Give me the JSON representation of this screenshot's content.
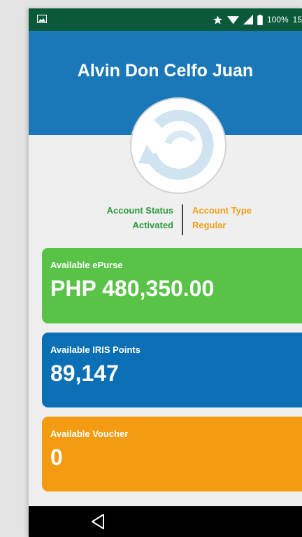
{
  "status_bar": {
    "battery_percent": "100%",
    "clock_partial": "15"
  },
  "profile": {
    "name": "Alvin Don Celfo Juan"
  },
  "account": {
    "status_label": "Account Status",
    "status_value": "Activated",
    "type_label": "Account Type",
    "type_value": "Regular"
  },
  "cards": [
    {
      "label": "Available ePurse",
      "value": "PHP 480,350.00",
      "color": "#58c347"
    },
    {
      "label": "Available IRIS Points",
      "value": "89,147",
      "color": "#0b6fb5"
    },
    {
      "label": "Available Voucher",
      "value": "0",
      "color": "#f39c12"
    }
  ],
  "colors": {
    "status_bar": "#0a5a3a",
    "header": "#1b78b8",
    "status_green": "#2e9b3f",
    "type_orange": "#f0a01a"
  }
}
